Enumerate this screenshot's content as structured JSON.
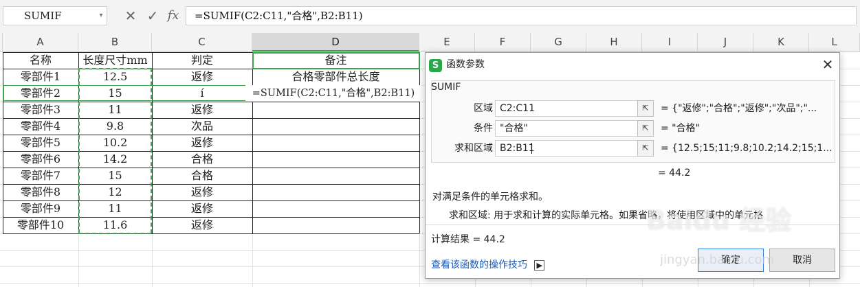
{
  "formula_bar": {
    "name_box": "SUMIF",
    "cancel_icon": "✕",
    "confirm_icon": "✓",
    "fx_icon": "fx",
    "formula": "=SUMIF(C2:C11,\"合格\",B2:B11)"
  },
  "columns": [
    "A",
    "B",
    "C",
    "D",
    "E",
    "F",
    "G",
    "H",
    "I",
    "J",
    "K",
    "L"
  ],
  "selected_column": "D",
  "table": {
    "headers": [
      "名称",
      "长度尺寸mm",
      "判定",
      "备注"
    ],
    "rows": [
      [
        "零部件1",
        "12.5",
        "返修",
        "合格零部件总长度"
      ],
      [
        "零部件2",
        "15",
        "í",
        "=SUMIF(C2:C11,\"合格\",B2:B11)"
      ],
      [
        "零部件3",
        "11",
        "返修",
        ""
      ],
      [
        "零部件4",
        "9.8",
        "次品",
        ""
      ],
      [
        "零部件5",
        "10.2",
        "返修",
        ""
      ],
      [
        "零部件6",
        "14.2",
        "合格",
        ""
      ],
      [
        "零部件7",
        "15",
        "合格",
        ""
      ],
      [
        "零部件8",
        "12",
        "返修",
        ""
      ],
      [
        "零部件9",
        "11",
        "返修",
        ""
      ],
      [
        "零部件10",
        "11.6",
        "返修",
        ""
      ]
    ]
  },
  "dialog": {
    "logo": "S",
    "title": "函数参数",
    "close": "✕",
    "function_name": "SUMIF",
    "params": [
      {
        "label": "区域",
        "value": "C2:C11",
        "result": "= {\"返修\";\"合格\";\"返修\";\"次品\";\"..."
      },
      {
        "label": "条件",
        "value": "\"合格\"",
        "result": "= \"合格\""
      },
      {
        "label": "求和区域",
        "value": "B2:B11",
        "result": "= {12.5;15;11;9.8;10.2;14.2;15;1..."
      }
    ],
    "pick_icon": "⇱",
    "overall_value": "= 44.2",
    "description": "对满足条件的单元格求和。",
    "param_help": "求和区域:  用于求和计算的实际单元格。如果省略，将使用区域中的单元格",
    "calc_result": "计算结果 = 44.2",
    "help_link": "查看该函数的操作技巧",
    "help_icon": "▶",
    "ok": "确定",
    "cancel": "取消"
  },
  "watermark": {
    "main": "Baidu 经验",
    "sub": "jingyan.baidu.com"
  }
}
